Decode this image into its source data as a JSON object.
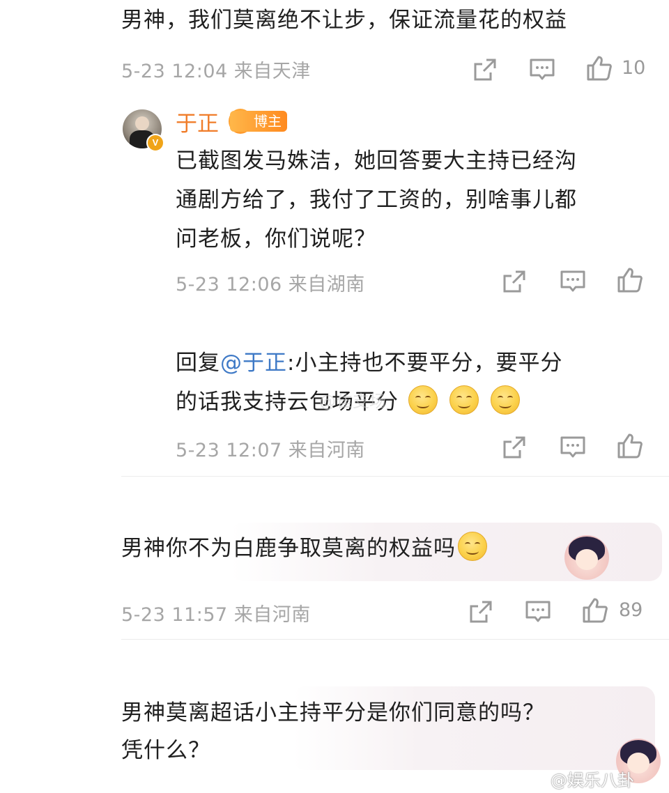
{
  "c1": {
    "text": "男神，我们莫离绝不让步，保证流量花的权益",
    "time": "5-23 12:04",
    "loc": "来自天津",
    "likes": "10"
  },
  "r1": {
    "user": "于正",
    "badge": "博主",
    "lines": [
      "已截图发马姝洁，她回答要大主持已经沟",
      "通剧方给了，我付了工资的，别啥事儿都",
      "问老板，你们说呢？"
    ],
    "time": "5-23 12:06",
    "loc": "来自湖南"
  },
  "r2": {
    "reply": "回复",
    "mention": "@于正",
    "text_a": ":小主持也不要平分，要平分",
    "text_b": "的话我支持云包场平分",
    "time": "5-23 12:07",
    "loc": "来自河南"
  },
  "c2": {
    "text": "男神你不为白鹿争取莫离的权益吗",
    "time": "5-23 11:57",
    "loc": "来自河南",
    "likes": "89"
  },
  "c3": {
    "lines": [
      "男神莫离超话小主持平分是你们同意的吗？",
      "凭什么？"
    ]
  },
  "watermark": {
    "center": "@隹支场",
    "corner": "@娱乐八卦"
  },
  "icons": {
    "share": "share-icon",
    "comment": "comment-icon",
    "like": "thumbs-up-icon"
  }
}
